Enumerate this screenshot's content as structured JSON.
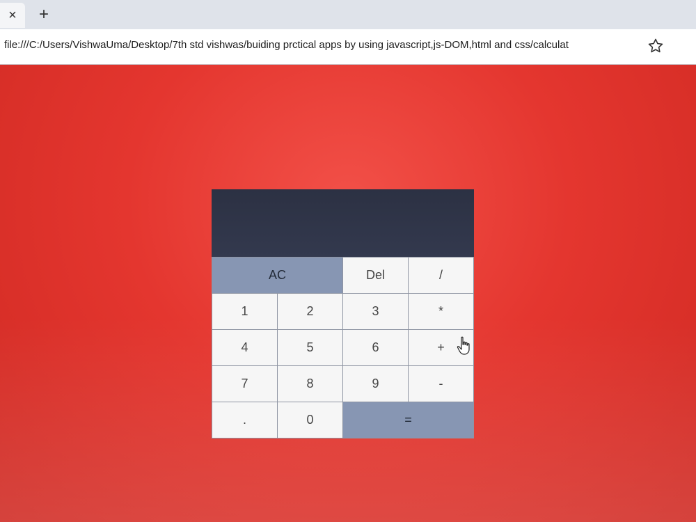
{
  "browser": {
    "close_tab_label": "×",
    "new_tab_label": "+",
    "url": "file:///C:/Users/VishwaUma/Desktop/7th std vishwas/buiding prctical apps by using javascript,js-DOM,html and css/calculat",
    "bookmark_icon": "star-icon"
  },
  "page": {
    "background_color": "#e83a34"
  },
  "calculator": {
    "display_value": "",
    "keys": [
      {
        "label": "AC",
        "name": "clear-button",
        "span": 2,
        "accent": true
      },
      {
        "label": "Del",
        "name": "delete-button"
      },
      {
        "label": "/",
        "name": "divide-button"
      },
      {
        "label": "1",
        "name": "digit-1-button"
      },
      {
        "label": "2",
        "name": "digit-2-button"
      },
      {
        "label": "3",
        "name": "digit-3-button"
      },
      {
        "label": "*",
        "name": "multiply-button"
      },
      {
        "label": "4",
        "name": "digit-4-button"
      },
      {
        "label": "5",
        "name": "digit-5-button"
      },
      {
        "label": "6",
        "name": "digit-6-button"
      },
      {
        "label": "+",
        "name": "add-button"
      },
      {
        "label": "7",
        "name": "digit-7-button"
      },
      {
        "label": "8",
        "name": "digit-8-button"
      },
      {
        "label": "9",
        "name": "digit-9-button"
      },
      {
        "label": "-",
        "name": "subtract-button"
      },
      {
        "label": ".",
        "name": "decimal-button"
      },
      {
        "label": "0",
        "name": "digit-0-button"
      },
      {
        "label": "=",
        "name": "equals-button",
        "span": 2,
        "accent": true
      }
    ],
    "accent_color": "#8796b3",
    "display_color": "#2c3143"
  },
  "cursor": {
    "icon": "hand-pointer-icon"
  }
}
